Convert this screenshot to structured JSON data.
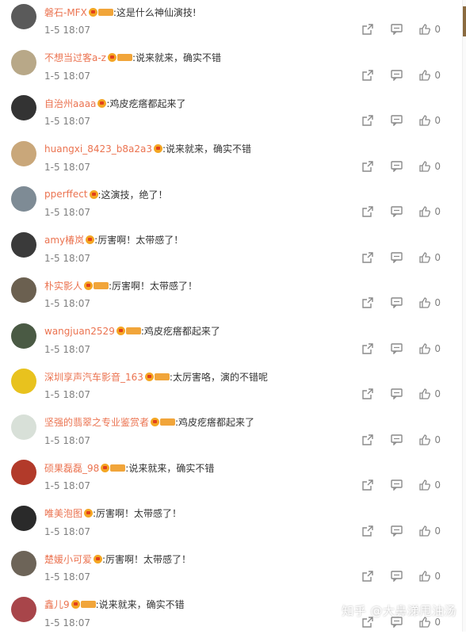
{
  "comments": [
    {
      "user": "磐石-MFX",
      "vip": true,
      "text": ":这是什么神仙演技!",
      "time": "1-5 18:07",
      "likes": "0",
      "avatar_color": "#5a5a5a"
    },
    {
      "user": "不想当过客a-z",
      "vip": true,
      "text": ":说来就来，确实不错",
      "time": "1-5 18:07",
      "likes": "0",
      "avatar_color": "#b8a888"
    },
    {
      "user": "自治州aaaa",
      "vip": false,
      "text": ":鸡皮疙瘩都起来了",
      "time": "1-5 18:07",
      "likes": "0",
      "avatar_color": "#333333"
    },
    {
      "user": "huangxi_8423_b8a2a3",
      "vip": false,
      "text": ":说来就来，确实不错",
      "time": "1-5 18:07",
      "likes": "0",
      "avatar_color": "#c9a77a"
    },
    {
      "user": "pperffect",
      "vip": false,
      "text": ":这演技，绝了！",
      "time": "1-5 18:07",
      "likes": "0",
      "avatar_color": "#7e8b95"
    },
    {
      "user": "amy椿岚",
      "vip": false,
      "text": ":厉害啊！太带感了！",
      "time": "1-5 18:07",
      "likes": "0",
      "avatar_color": "#3a3a3a"
    },
    {
      "user": "朴实影人",
      "vip": true,
      "text": ":厉害啊！太带感了！",
      "time": "1-5 18:07",
      "likes": "0",
      "avatar_color": "#6b6050"
    },
    {
      "user": "wangjuan2529",
      "vip": true,
      "text": ":鸡皮疙瘩都起来了",
      "time": "1-5 18:07",
      "likes": "0",
      "avatar_color": "#4a5a44"
    },
    {
      "user": "深圳享声汽车影音_163",
      "vip": true,
      "text": ":太厉害咯，演的不错呢",
      "time": "1-5 18:07",
      "likes": "0",
      "avatar_color": "#e8c21e"
    },
    {
      "user": "坚强的翡翠之专业鉴赏者",
      "vip": true,
      "text": ":鸡皮疙瘩都起来了",
      "time": "1-5 18:07",
      "likes": "0",
      "avatar_color": "#d8e0d8"
    },
    {
      "user": "硕果磊磊_98",
      "vip": true,
      "text": ":说来就来，确实不错",
      "time": "1-5 18:07",
      "likes": "0",
      "avatar_color": "#b23a2a"
    },
    {
      "user": "唯美泡图",
      "vip": false,
      "text": ":厉害啊！太带感了！",
      "time": "1-5 18:07",
      "likes": "0",
      "avatar_color": "#2a2a2a"
    },
    {
      "user": "楚媛小可爱",
      "vip": false,
      "text": ":厉害啊！太带感了！",
      "time": "1-5 18:07",
      "likes": "0",
      "avatar_color": "#6d6458"
    },
    {
      "user": "鑫儿9",
      "vip": true,
      "text": ":说来就来，确实不错",
      "time": "1-5 18:07",
      "likes": "0",
      "avatar_color": "#a8454a"
    }
  ],
  "watermark": "知乎 @大鼻涕甩油汤",
  "colors": {
    "username": "#eb7350",
    "text": "#333333",
    "meta": "#808080"
  },
  "icons": {
    "share": "share-icon",
    "comment": "comment-icon",
    "like": "thumbs-up-icon"
  }
}
